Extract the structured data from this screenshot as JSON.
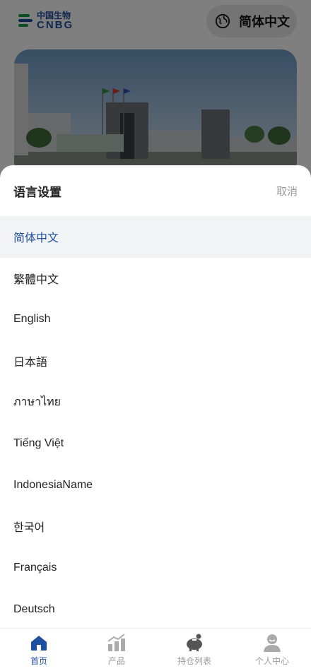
{
  "header": {
    "logo": {
      "cn": "中国生物",
      "en": "CNBG"
    },
    "language_button": {
      "label": "简体中文",
      "icon": "globe-icon"
    }
  },
  "language_sheet": {
    "title": "语言设置",
    "cancel_label": "取消",
    "selected": "简体中文",
    "options": [
      "简体中文",
      "繁體中文",
      "English",
      "日本語",
      "ภาษาไทย",
      "Tiếng Việt",
      "IndonesiaName",
      "한국어",
      "Français",
      "Deutsch"
    ]
  },
  "tabbar": {
    "items": [
      {
        "label": "首页",
        "icon": "home-icon",
        "active": true
      },
      {
        "label": "产品",
        "icon": "chart-icon",
        "active": false
      },
      {
        "label": "持仓列表",
        "icon": "piggy-bank-icon",
        "active": false
      },
      {
        "label": "个人中心",
        "icon": "user-icon",
        "active": false
      }
    ]
  },
  "colors": {
    "accent": "#1f4fa0",
    "selected_bg": "#f2f3f5",
    "inactive": "#999999",
    "overlay": "rgba(0,0,0,0.5)"
  }
}
